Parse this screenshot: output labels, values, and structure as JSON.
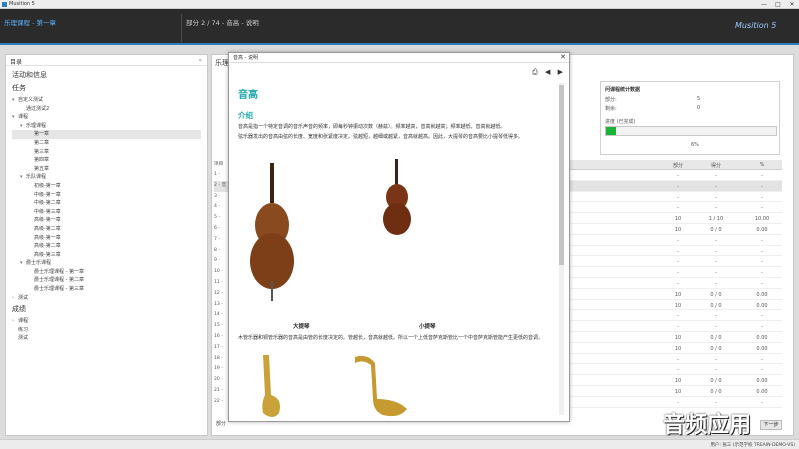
{
  "window": {
    "title": "Musition 5",
    "minimize": "—",
    "maximize": "□",
    "close": "✕"
  },
  "header": {
    "course": "乐理课程 - 第一章",
    "section": "部分 2 / 74 - 音高 - 说明",
    "logo": "Musition 5"
  },
  "left_panel": {
    "title": "目录",
    "close": "«",
    "groups": [
      {
        "label": "活动和信息",
        "kind": "h1"
      },
      {
        "label": "任务",
        "kind": "h1"
      },
      {
        "label": "自定义测试",
        "indent": 1,
        "arrow": "▾"
      },
      {
        "label": "通过测试2",
        "indent": 2
      },
      {
        "label": "课程",
        "indent": 1,
        "arrow": "▾"
      },
      {
        "label": "乐理课程",
        "indent": 2,
        "arrow": "▾"
      },
      {
        "label": "第一章",
        "indent": 3,
        "selected": true
      },
      {
        "label": "第二章",
        "indent": 3
      },
      {
        "label": "第三章",
        "indent": 3
      },
      {
        "label": "第四章",
        "indent": 3
      },
      {
        "label": "第五章",
        "indent": 3
      },
      {
        "label": "乐队课程",
        "indent": 2,
        "arrow": "▾"
      },
      {
        "label": "初级-第一章",
        "indent": 3
      },
      {
        "label": "中级-第一章",
        "indent": 3
      },
      {
        "label": "中级-第二章",
        "indent": 3
      },
      {
        "label": "中级-第三章",
        "indent": 3
      },
      {
        "label": "高级-第一章",
        "indent": 3
      },
      {
        "label": "高级-第二章",
        "indent": 3
      },
      {
        "label": "高级-第一章",
        "indent": 3
      },
      {
        "label": "高级-第二章",
        "indent": 3
      },
      {
        "label": "高级-第三章",
        "indent": 3
      },
      {
        "label": "爵士乐课程",
        "indent": 2,
        "arrow": "▾"
      },
      {
        "label": "爵士乐理课程 - 第一章",
        "indent": 3
      },
      {
        "label": "爵士乐理课程 - 第二章",
        "indent": 3
      },
      {
        "label": "爵士乐理课程 - 第三章",
        "indent": 3
      },
      {
        "label": "测试",
        "indent": 1,
        "arrow": "›"
      },
      {
        "label": "成绩",
        "kind": "h1"
      },
      {
        "label": "课程",
        "indent": 1,
        "arrow": "›"
      },
      {
        "label": "练习",
        "indent": 1
      },
      {
        "label": "测试",
        "indent": 1
      }
    ]
  },
  "right_panel": {
    "title": "乐理课程 - 第一章"
  },
  "stats": {
    "title": "问课程统计数据",
    "rows": [
      {
        "label": "部分:",
        "value": "5"
      },
      {
        "label": "剩余:",
        "value": "0"
      }
    ],
    "progress_label": "进度 (已完成)",
    "progress": 0.06,
    "progress_text": "6%"
  },
  "table": {
    "headers": [
      "部分",
      "得分",
      "%"
    ],
    "rows": [
      [
        "-",
        "-",
        "-"
      ],
      [
        "-",
        "-",
        "-"
      ],
      [
        "-",
        "-",
        "-"
      ],
      [
        "-",
        "-",
        "-"
      ],
      [
        "10",
        "1 / 10",
        "10.00"
      ],
      [
        "10",
        "0 / 0",
        "0.00"
      ],
      [
        "-",
        "-",
        "-"
      ],
      [
        "-",
        "-",
        "-"
      ],
      [
        "-",
        "-",
        "-"
      ],
      [
        "-",
        "-",
        "-"
      ],
      [
        "-",
        "-",
        "-"
      ],
      [
        "10",
        "0 / 0",
        "0.00"
      ],
      [
        "10",
        "0 / 0",
        "0.00"
      ],
      [
        "-",
        "-",
        "-"
      ],
      [
        "-",
        "-",
        "-"
      ],
      [
        "10",
        "0 / 0",
        "0.00"
      ],
      [
        "10",
        "0 / 0",
        "0.00"
      ],
      [
        "-",
        "-",
        "-"
      ],
      [
        "-",
        "-",
        "-"
      ],
      [
        "10",
        "0 / 0",
        "0.00"
      ],
      [
        "10",
        "0 / 0",
        "0.00"
      ],
      [
        "-",
        "-",
        "-"
      ]
    ]
  },
  "left_table": {
    "header": "项目",
    "rows": [
      "1 -",
      "2 - 音",
      "3 -",
      "4 -",
      "5 -",
      "6 -",
      "7 -",
      "8 -",
      "9 -",
      "10 -",
      "11 -",
      "12 -",
      "13 -",
      "14 -",
      "15 -",
      "16 -",
      "17 -",
      "18 -",
      "19 -",
      "20 -",
      "21 -",
      "22 -"
    ]
  },
  "dialog": {
    "title": "音高 - 说明",
    "close": "✕",
    "print": "⎙",
    "prev": "◀",
    "next": "▶",
    "heading": "音高",
    "subheading": "介绍",
    "para1": "音高是指一个特定音调的音乐声音的频率，即每秒钟振动次数（赫兹）。频率越高，音高就越高；频率越低，音高就越低。",
    "para2": "弦乐器发出的音高由弦的长度、宽度和张紧度决定。弦越短，越细或越紧，音高就越高。因此，大提琴的音高要比小提琴低得多。",
    "caption1": "大提琴",
    "caption2": "小提琴",
    "para3": "木管乐器和铜管乐器的音高是由管的长度决定的。管越长，音高就越低。所以一个上低音萨克斯管比一个中音萨克斯管能产生更低的音调。"
  },
  "bottom": {
    "label": "部分",
    "next_button": "下一步"
  },
  "footer": {
    "user": "用户: 张三 (示范学校 TREAIN-DEMO-VS)"
  },
  "watermark": "音频应用",
  "colors": {
    "accent": "#2a7fc1",
    "heading": "#22aab0",
    "progress": "#19b33a",
    "header_bg": "#2b2b2b"
  }
}
